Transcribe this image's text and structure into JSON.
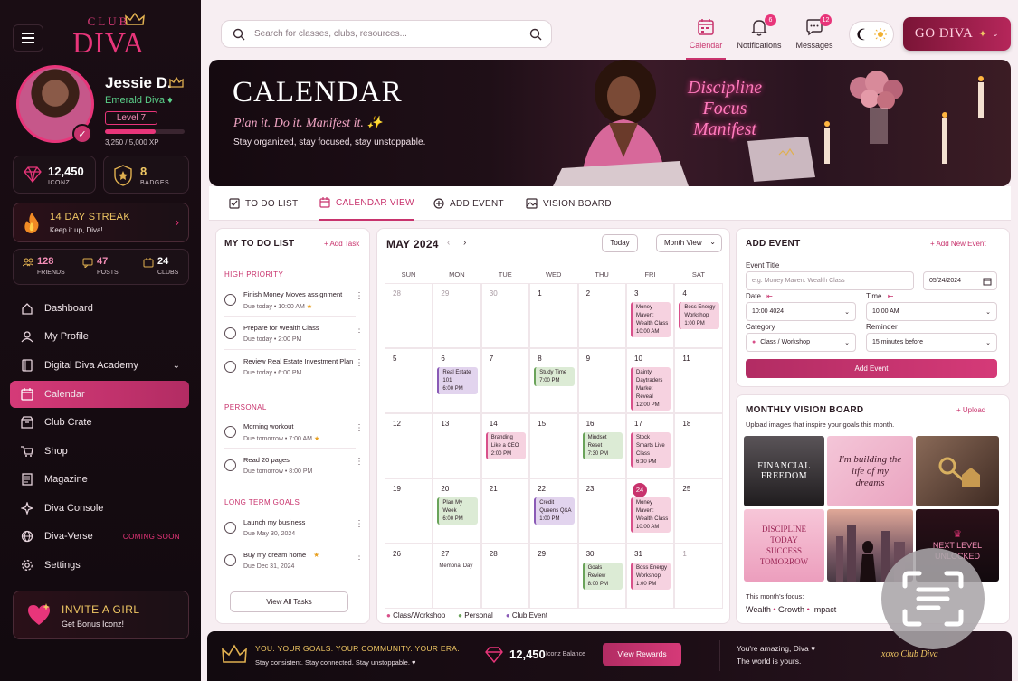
{
  "brand": {
    "club": "CLUB",
    "diva": "DIVA"
  },
  "profile": {
    "name": "Jessie D.",
    "rank": "Emerald Diva",
    "level": "Level 7",
    "xp": "3,250 / 5,000 XP",
    "xp_fraction": 0.65
  },
  "stats": {
    "iconz": {
      "value": "12,450",
      "label": "ICONZ"
    },
    "badges": {
      "value": "8",
      "label": "BADGES"
    }
  },
  "streak": {
    "title": "14 DAY STREAK",
    "sub": "Keep it up, Diva!"
  },
  "social": [
    {
      "value": "128",
      "label": "FRIENDS",
      "icon": "friends-icon"
    },
    {
      "value": "47",
      "label": "POSTS",
      "icon": "posts-icon"
    },
    {
      "value": "24",
      "label": "CLUBS",
      "icon": "clubs-icon"
    }
  ],
  "nav": [
    {
      "label": "Dashboard",
      "icon": "home-icon"
    },
    {
      "label": "My Profile",
      "icon": "user-icon"
    },
    {
      "label": "Digital Diva Academy",
      "icon": "book-icon"
    },
    {
      "label": "Calendar",
      "icon": "calendar-icon",
      "active": true
    },
    {
      "label": "Club Crate",
      "icon": "crate-icon"
    },
    {
      "label": "Shop",
      "icon": "cart-icon"
    },
    {
      "label": "Magazine",
      "icon": "magazine-icon"
    },
    {
      "label": "Diva Console",
      "icon": "console-icon"
    },
    {
      "label": "Diva-Verse",
      "icon": "globe-icon",
      "tag": "COMING SOON"
    },
    {
      "label": "Settings",
      "icon": "gear-icon"
    }
  ],
  "invite": {
    "title": "INVITE A GIRL",
    "sub": "Get Bonus Iconz!"
  },
  "search": {
    "placeholder": "Search for classes, clubs, resources..."
  },
  "topnav": [
    {
      "label": "Calendar",
      "icon": "calendar-icon",
      "active": true
    },
    {
      "label": "Notifications",
      "icon": "bell-icon",
      "badge": "6"
    },
    {
      "label": "Messages",
      "icon": "chat-icon",
      "badge": "12"
    }
  ],
  "godiva": "GO DIVA",
  "hero": {
    "title": "CALENDAR",
    "tagline": "Plan it. Do it. Manifest it. ✨",
    "sub": "Stay organized, stay focused, stay unstoppable.",
    "neon": [
      "Discipline",
      "Focus",
      "Manifest"
    ]
  },
  "tabs": [
    "TO DO LIST",
    "CALENDAR VIEW",
    "ADD EVENT",
    "VISION BOARD"
  ],
  "todo": {
    "title": "MY TO DO LIST",
    "add": "+ Add Task",
    "sections": [
      {
        "name": "HIGH PRIORITY",
        "tasks": [
          {
            "title": "Finish Money Moves assignment",
            "due": "Due today • 10:00 AM",
            "star": true
          },
          {
            "title": "Prepare for Wealth Class",
            "due": "Due today • 2:00 PM"
          },
          {
            "title": "Review Real Estate Investment Plan",
            "due": "Due today • 6:00 PM"
          }
        ]
      },
      {
        "name": "PERSONAL",
        "tasks": [
          {
            "title": "Morning workout",
            "due": "Due tomorrow • 7:00 AM",
            "star": true
          },
          {
            "title": "Read 20 pages",
            "due": "Due tomorrow • 8:00 PM"
          }
        ]
      },
      {
        "name": "LONG TERM GOALS",
        "tasks": [
          {
            "title": "Launch my business",
            "due": "Due May 30, 2024"
          },
          {
            "title": "Buy my dream home",
            "due": "Due Dec 31, 2024",
            "star": true
          }
        ]
      }
    ],
    "view_all": "View All Tasks"
  },
  "calendar": {
    "month": "MAY 2024",
    "today_btn": "Today",
    "view_select": "Month View",
    "dows": [
      "SUN",
      "MON",
      "TUE",
      "WED",
      "THU",
      "FRI",
      "SAT"
    ],
    "legend": [
      {
        "label": "Class/Workshop",
        "color": "#d8508a"
      },
      {
        "label": "Personal",
        "color": "#6aa35a"
      },
      {
        "label": "Club Event",
        "color": "#8a5ab6"
      }
    ],
    "weeks": [
      [
        {
          "d": "28",
          "o": true
        },
        {
          "d": "29",
          "o": true
        },
        {
          "d": "30",
          "o": true
        },
        {
          "d": "1"
        },
        {
          "d": "2"
        },
        {
          "d": "3",
          "ev": [
            {
              "t": "Money Maven: Wealth Class",
              "time": "10:00 AM",
              "c": "pink"
            }
          ]
        },
        {
          "d": "4",
          "ev": [
            {
              "t": "Boss Energy Workshop",
              "time": "1:00 PM",
              "c": "pink"
            }
          ]
        }
      ],
      [
        {
          "d": "5"
        },
        {
          "d": "6",
          "ev": [
            {
              "t": "Real Estate 101",
              "time": "6:00 PM",
              "c": "purple"
            }
          ]
        },
        {
          "d": "7"
        },
        {
          "d": "8",
          "ev": [
            {
              "t": "Study Time",
              "time": "7:00 PM",
              "c": "green"
            }
          ]
        },
        {
          "d": "9"
        },
        {
          "d": "10",
          "ev": [
            {
              "t": "Dainty Daytraders Market Reveal",
              "time": "12:00 PM",
              "c": "pink"
            }
          ]
        },
        {
          "d": "11"
        }
      ],
      [
        {
          "d": "12"
        },
        {
          "d": "13"
        },
        {
          "d": "14",
          "ev": [
            {
              "t": "Branding Like a CEO",
              "time": "2:00 PM",
              "c": "pink"
            }
          ]
        },
        {
          "d": "15"
        },
        {
          "d": "16",
          "ev": [
            {
              "t": "Mindset Reset",
              "time": "7:30 PM",
              "c": "green"
            }
          ]
        },
        {
          "d": "17",
          "ev": [
            {
              "t": "Stock Smarts Live Class",
              "time": "6:30 PM",
              "c": "pink"
            }
          ]
        },
        {
          "d": "18"
        }
      ],
      [
        {
          "d": "19"
        },
        {
          "d": "20",
          "ev": [
            {
              "t": "Plan My Week",
              "time": "6:00 PM",
              "c": "green"
            }
          ]
        },
        {
          "d": "21"
        },
        {
          "d": "22",
          "ev": [
            {
              "t": "Credit Queens Q&A",
              "time": "1:00 PM",
              "c": "purple"
            }
          ]
        },
        {
          "d": "23"
        },
        {
          "d": "24",
          "today": true,
          "ev": [
            {
              "t": "Money Maven: Wealth Class",
              "time": "10:00 AM",
              "c": "pink"
            }
          ]
        },
        {
          "d": "25"
        }
      ],
      [
        {
          "d": "26"
        },
        {
          "d": "27",
          "note": "Memorial Day"
        },
        {
          "d": "28"
        },
        {
          "d": "29"
        },
        {
          "d": "30",
          "ev": [
            {
              "t": "Goals Review",
              "time": "8:00 PM",
              "c": "green"
            }
          ]
        },
        {
          "d": "31",
          "ev": [
            {
              "t": "Boss Energy Workshop",
              "time": "1:00 PM",
              "c": "pink"
            }
          ]
        },
        {
          "d": "1",
          "o": true
        }
      ]
    ]
  },
  "add_event": {
    "title": "ADD EVENT",
    "add_new": "+ Add New Event",
    "event_title_label": "Event Title",
    "event_title_placeholder": "e.g. Money Maven: Wealth Class",
    "date_short": "05/24/2024",
    "date_label": "Date",
    "date_value": "10:00 4024",
    "time_label": "Time",
    "time_value": "10:00 AM",
    "category_label": "Category",
    "category_value": "Class / Workshop",
    "reminder_label": "Reminder",
    "reminder_value": "15 minutes before",
    "button": "Add Event"
  },
  "vision": {
    "title": "MONTHLY VISION BOARD",
    "upload": "+ Upload",
    "sub": "Upload images that inspire your goals this month.",
    "tiles": [
      {
        "text": "FINANCIAL FREEDOM"
      },
      {
        "text": "I'm building the life of my dreams"
      },
      {
        "text": ""
      },
      {
        "text": "DISCIPLINE TODAY SUCCESS TOMORROW"
      },
      {
        "text": ""
      },
      {
        "text": "NEXT LEVEL UNLOCKED"
      }
    ],
    "focus_label": "This month's focus:",
    "focus": [
      "Wealth",
      "Growth",
      "Impact"
    ]
  },
  "footer": {
    "slogan": "YOU. YOUR GOALS. YOUR COMMUNITY. YOUR ERA.",
    "slogan_sub": "Stay consistent. Stay connected. Stay unstoppable. ♥",
    "balance": "12,450",
    "balance_label": "Iconz Balance",
    "rewards_btn": "View Rewards",
    "msg1": "You're amazing, Diva ♥",
    "msg2": "The world is yours.",
    "sign": "xoxo Club Diva"
  },
  "colors": {
    "accent": "#c8336d",
    "sidebar": "#1a0d14",
    "page": "#f7eef2"
  }
}
